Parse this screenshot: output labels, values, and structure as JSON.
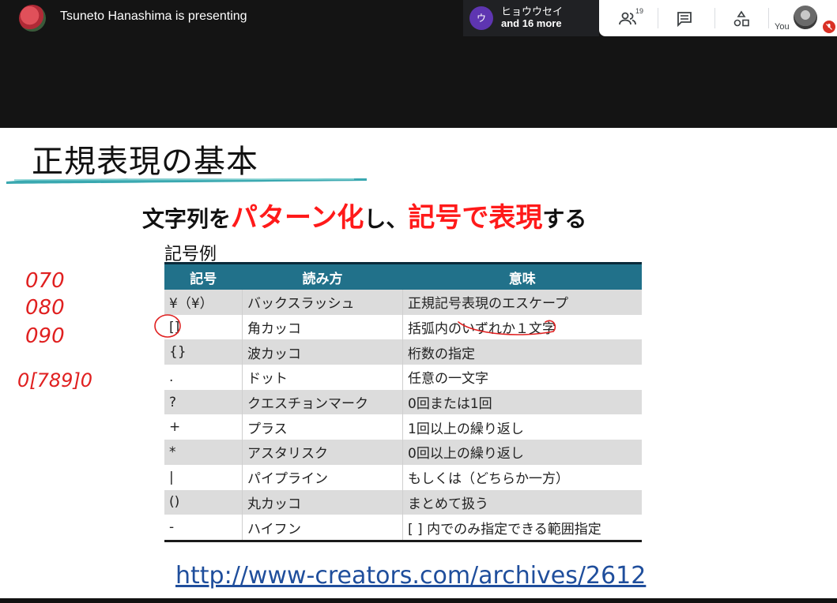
{
  "meeting": {
    "presenter_text": "Tsuneto Hanashima is presenting",
    "participant_name": "ヒョウウセイ",
    "participant_initial": "ウ",
    "participant_more": "and 16 more",
    "people_count": "19",
    "you_label": "You",
    "icons": [
      "people-icon",
      "chat-icon",
      "activities-icon",
      "mic-off-icon"
    ]
  },
  "slide": {
    "title": "正規表現の基本",
    "headline": {
      "part1": "文字列を",
      "part2": "パターン化",
      "part3": "し、",
      "part4": "記号で表現",
      "part5": "する"
    },
    "section_label": "記号例",
    "table": {
      "headers": [
        "記号",
        "読み方",
        "意味"
      ],
      "rows": [
        [
          "¥（¥）",
          "バックスラッシュ",
          "正規記号表現のエスケープ"
        ],
        [
          "[]",
          "角カッコ",
          "括弧内のいずれか１文字"
        ],
        [
          "{}",
          "波カッコ",
          "桁数の指定"
        ],
        [
          ".",
          "ドット",
          "任意の一文字"
        ],
        [
          "?",
          "クエスチョンマーク",
          "0回または1回"
        ],
        [
          "+",
          "プラス",
          "1回以上の繰り返し"
        ],
        [
          "*",
          "アスタリスク",
          "0回以上の繰り返し"
        ],
        [
          "|",
          "パイプライン",
          "もしくは（どちらか一方）"
        ],
        [
          "()",
          "丸カッコ",
          "まとめて扱う"
        ],
        [
          "-",
          "ハイフン",
          "[ ] 内でのみ指定できる範囲指定"
        ]
      ]
    },
    "source_url": "http://www-creators.com/archives/2612",
    "handwritten_notes": [
      "070",
      "080",
      "090",
      "0[789]0"
    ]
  },
  "colors": {
    "accent_red": "#ff1a1a",
    "table_header": "#21718a",
    "annotation_red": "#e02020",
    "link": "#1f4e9c"
  }
}
